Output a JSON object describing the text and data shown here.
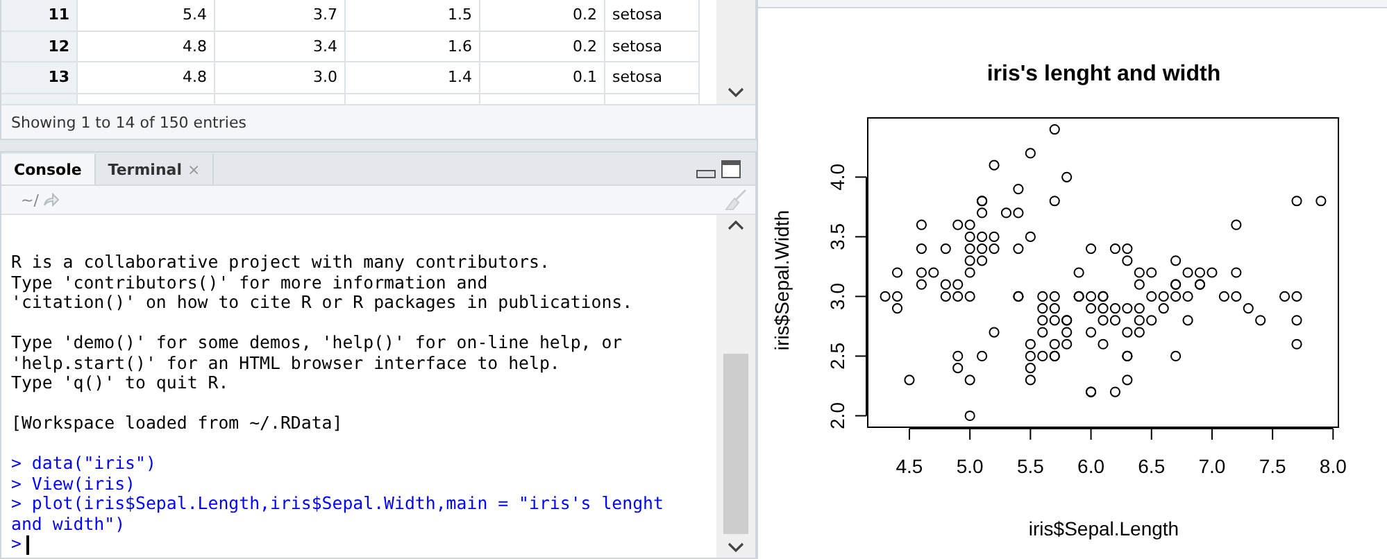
{
  "data_viewer": {
    "rows": [
      {
        "cells": [
          "11",
          "5.4",
          "3.7",
          "1.5",
          "0.2",
          "setosa"
        ]
      },
      {
        "cells": [
          "12",
          "4.8",
          "3.4",
          "1.6",
          "0.2",
          "setosa"
        ]
      },
      {
        "cells": [
          "13",
          "4.8",
          "3.0",
          "1.4",
          "0.1",
          "setosa"
        ]
      }
    ],
    "footer": "Showing 1 to 14 of 150 entries"
  },
  "console": {
    "tabs": [
      {
        "label": "Console",
        "selected": true
      },
      {
        "label": "Terminal",
        "selected": false,
        "close": "×"
      }
    ],
    "path": "~/",
    "lines": [
      {
        "kind": "output",
        "text": "R is a collaborative project with many contributors."
      },
      {
        "kind": "output",
        "text": "Type 'contributors()' for more information and"
      },
      {
        "kind": "output",
        "text": "'citation()' on how to cite R or R packages in publications."
      },
      {
        "kind": "blank"
      },
      {
        "kind": "output",
        "text": "Type 'demo()' for some demos, 'help()' for on-line help, or"
      },
      {
        "kind": "output",
        "text": "'help.start()' for an HTML browser interface to help."
      },
      {
        "kind": "output",
        "text": "Type 'q()' to quit R."
      },
      {
        "kind": "blank"
      },
      {
        "kind": "output",
        "text": "[Workspace loaded from ~/.RData]"
      },
      {
        "kind": "blank"
      },
      {
        "kind": "input",
        "prompt": ">",
        "text": "data(\"iris\")"
      },
      {
        "kind": "input",
        "prompt": ">",
        "text": "View(iris)"
      },
      {
        "kind": "input",
        "prompt": ">",
        "text": "plot(iris$Sepal.Length,iris$Sepal.Width,main = \"iris's lenght and width\")"
      },
      {
        "kind": "cursor",
        "prompt": ">"
      }
    ]
  },
  "plot": {
    "chart_data": {
      "type": "scatter",
      "title": "iris's lenght and width",
      "xlabel": "iris$Sepal.Length",
      "ylabel": "iris$Sepal.Width",
      "xlim": [
        4.156,
        8.044
      ],
      "ylim": [
        1.904,
        4.496
      ],
      "xticks": [
        {
          "value": 4.5,
          "label": "4.5"
        },
        {
          "value": 5,
          "label": "5.0"
        },
        {
          "value": 5.5,
          "label": "5.5"
        },
        {
          "value": 6,
          "label": "6.0"
        },
        {
          "value": 6.5,
          "label": "6.5"
        },
        {
          "value": 7,
          "label": "7.0"
        },
        {
          "value": 7.5,
          "label": "7.5"
        },
        {
          "value": 8,
          "label": "8.0"
        }
      ],
      "yticks": [
        {
          "value": 2,
          "label": "2.0"
        },
        {
          "value": 2.5,
          "label": "2.5"
        },
        {
          "value": 3,
          "label": "3.0"
        },
        {
          "value": 3.5,
          "label": "3.5"
        },
        {
          "value": 4,
          "label": "4.0"
        }
      ],
      "x": [
        5.1,
        4.9,
        4.7,
        4.6,
        5.0,
        5.4,
        4.6,
        5.0,
        4.4,
        4.9,
        5.4,
        4.8,
        4.8,
        4.3,
        5.8,
        5.7,
        5.7,
        5.1,
        5.4,
        5.1,
        4.6,
        5.1,
        5.0,
        5.2,
        5.2,
        4.8,
        5.2,
        5.5,
        5.0,
        5.5,
        4.9,
        4.4,
        5.1,
        5.0,
        4.5,
        4.4,
        5.1,
        4.6,
        5.3,
        5.0,
        7.0,
        6.4,
        6.9,
        5.5,
        6.5,
        5.7,
        6.3,
        4.9,
        6.6,
        5.2,
        5.0,
        5.9,
        6.0,
        6.1,
        5.6,
        6.7,
        5.6,
        5.8,
        6.2,
        5.6,
        5.9,
        6.1,
        6.3,
        6.4,
        6.6,
        6.8,
        6.7,
        6.0,
        5.7,
        5.5,
        6.0,
        5.4,
        6.0,
        6.3,
        5.5,
        5.5,
        6.1,
        5.8,
        5.0,
        5.6,
        5.7,
        5.7,
        6.2,
        5.1,
        5.7,
        5.8,
        7.1,
        6.3,
        6.5,
        7.6,
        7.3,
        6.7,
        7.2,
        6.5,
        6.4,
        6.8,
        5.7,
        5.8,
        7.7,
        7.7,
        6.0,
        6.9,
        5.6,
        7.7,
        6.3,
        6.7,
        7.2,
        6.2,
        6.1,
        6.4,
        7.2,
        7.4,
        7.9,
        6.1,
        7.7,
        6.3,
        6.4,
        6.0,
        6.9,
        6.8,
        6.7,
        6.3,
        6.2,
        5.9,
        4.9,
        5.4
      ],
      "series": [
        {
          "values": [
            3.5,
            3.0,
            3.2,
            3.1,
            3.6,
            3.9,
            3.4,
            3.4,
            2.9,
            3.1,
            3.7,
            3.4,
            3.0,
            3.0,
            4.0,
            4.4,
            3.8,
            3.8,
            3.4,
            3.7,
            3.6,
            3.3,
            3.0,
            3.5,
            3.4,
            3.1,
            4.1,
            4.2,
            3.2,
            3.5,
            3.6,
            3.0,
            3.4,
            3.5,
            2.3,
            3.2,
            3.8,
            3.2,
            3.7,
            3.3,
            3.2,
            3.2,
            3.1,
            2.3,
            2.8,
            2.8,
            3.3,
            2.4,
            2.9,
            2.7,
            2.0,
            3.0,
            2.2,
            2.9,
            2.9,
            3.1,
            3.0,
            2.7,
            2.2,
            2.5,
            3.2,
            2.8,
            2.5,
            2.9,
            3.0,
            2.8,
            3.0,
            2.9,
            2.6,
            2.4,
            2.7,
            3.0,
            3.4,
            2.3,
            2.5,
            2.6,
            3.0,
            2.6,
            2.3,
            2.7,
            3.0,
            2.9,
            2.9,
            2.5,
            2.5,
            2.8,
            3.0,
            2.9,
            3.0,
            3.0,
            2.9,
            2.5,
            3.6,
            3.2,
            2.7,
            3.0,
            2.5,
            2.8,
            3.8,
            2.6,
            2.2,
            3.2,
            2.8,
            2.8,
            2.7,
            3.3,
            3.2,
            2.8,
            3.0,
            2.8,
            3.0,
            2.8,
            3.8,
            2.6,
            3.0,
            3.4,
            3.1,
            3.0,
            3.1,
            3.2,
            3.1,
            2.5,
            3.4,
            3.0,
            2.5,
            3.0
          ]
        }
      ]
    }
  }
}
